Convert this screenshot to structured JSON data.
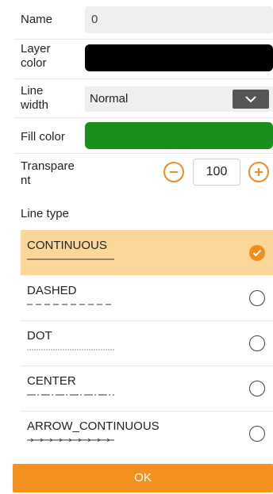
{
  "form": {
    "name_label": "Name",
    "name_value": "0",
    "layer_color_label_1": "Layer",
    "layer_color_label_2": "color",
    "layer_color": "#000000",
    "line_width_label_1": "Line",
    "line_width_label_2": "width",
    "line_width_value": "Normal",
    "fill_color_label": "Fill color",
    "fill_color": "#1b8f1b",
    "transparency_label_1": "Transpare",
    "transparency_label_2": "nt",
    "transparency_value": "100",
    "line_type_label": "Line type"
  },
  "line_types": [
    {
      "name": "CONTINUOUS",
      "selected": true,
      "pattern": "continuous"
    },
    {
      "name": "DASHED",
      "selected": false,
      "pattern": "dashed"
    },
    {
      "name": "DOT",
      "selected": false,
      "pattern": "dot"
    },
    {
      "name": "CENTER",
      "selected": false,
      "pattern": "center"
    },
    {
      "name": "ARROW_CONTINUOUS",
      "selected": false,
      "pattern": "arrow"
    }
  ],
  "colors": {
    "accent": "#f28c1e",
    "selected_bg": "#fcd79a",
    "ok_button": "#f4901d"
  },
  "actions": {
    "ok_label": "OK"
  },
  "icons": {
    "minus": "minus-circle-icon",
    "plus": "plus-circle-icon",
    "dropdown": "chevron-down-icon",
    "check": "check-icon"
  }
}
